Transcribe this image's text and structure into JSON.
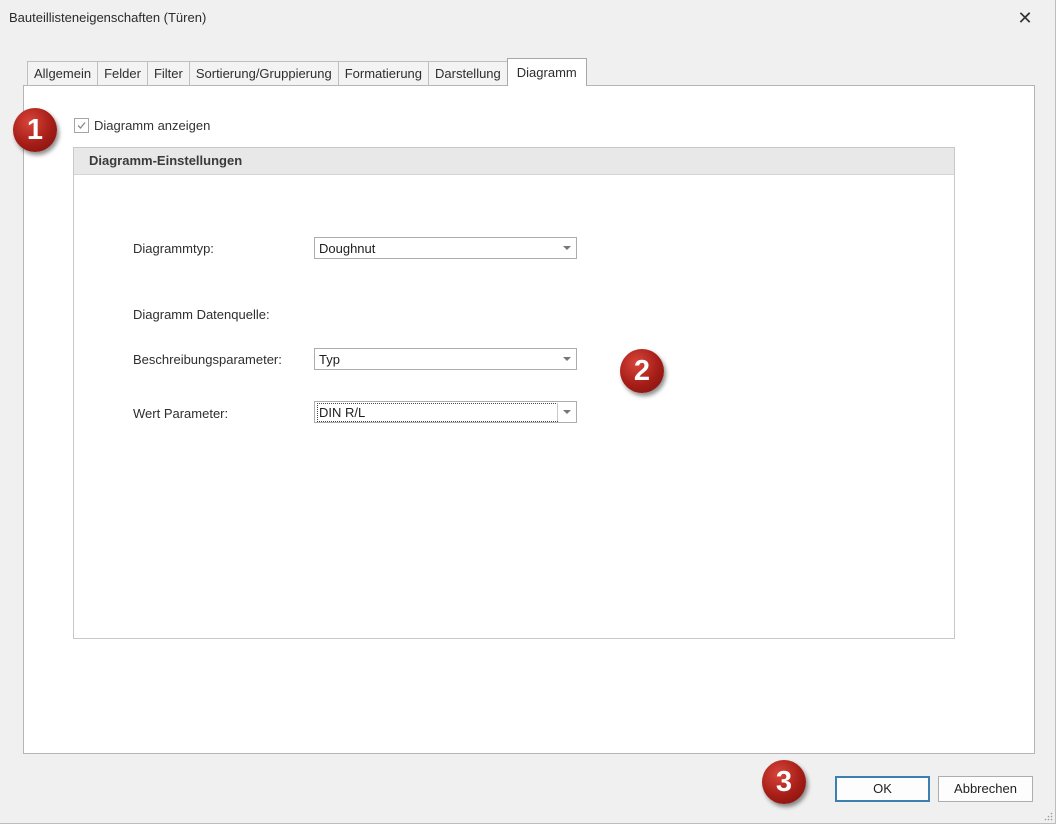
{
  "window": {
    "title": "Bauteillisteneigenschaften (Türen)",
    "close_icon": "close-icon"
  },
  "tabs": [
    {
      "label": "Allgemein",
      "active": false
    },
    {
      "label": "Felder",
      "active": false
    },
    {
      "label": "Filter",
      "active": false
    },
    {
      "label": "Sortierung/Gruppierung",
      "active": false
    },
    {
      "label": "Formatierung",
      "active": false
    },
    {
      "label": "Darstellung",
      "active": false
    },
    {
      "label": "Diagramm",
      "active": true
    }
  ],
  "diagram": {
    "show_label": "Diagramm anzeigen",
    "show_checked": true,
    "group_title": "Diagramm-Einstellungen",
    "type_label": "Diagrammtyp:",
    "type_value": "Doughnut",
    "datasource_label": "Diagramm Datenquelle:",
    "desc_param_label": "Beschreibungsparameter:",
    "desc_param_value": "Typ",
    "value_param_label": "Wert Parameter:",
    "value_param_value": "DIN R/L"
  },
  "badges": [
    "1",
    "2",
    "3"
  ],
  "buttons": {
    "ok": "OK",
    "cancel": "Abbrechen"
  },
  "colors": {
    "badge": "#a51d17",
    "ok_border": "#3c7fb1"
  }
}
